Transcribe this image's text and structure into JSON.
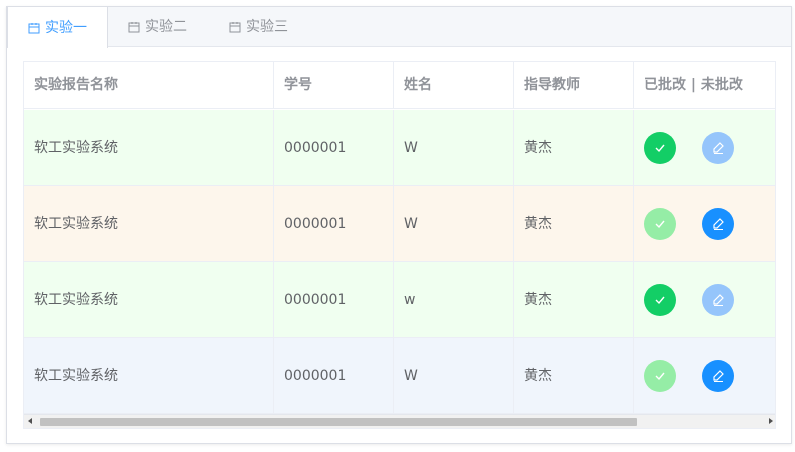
{
  "tabs": [
    {
      "label": "实验一",
      "active": true
    },
    {
      "label": "实验二",
      "active": false
    },
    {
      "label": "实验三",
      "active": false
    }
  ],
  "table": {
    "headers": [
      "实验报告名称",
      "学号",
      "姓名",
      "指导教师",
      "已批改 | 未批改"
    ],
    "rows": [
      {
        "name": "软工实验系统",
        "id": "0000001",
        "student": "W",
        "teacher": "黄杰",
        "bg": "#f0fff0",
        "graded_active": true
      },
      {
        "name": "软工实验系统",
        "id": "0000001",
        "student": "W",
        "teacher": "黄杰",
        "bg": "#fdf6ec",
        "graded_active": false
      },
      {
        "name": "软工实验系统",
        "id": "0000001",
        "student": "w",
        "teacher": "黄杰",
        "bg": "#f0fff0",
        "graded_active": true
      },
      {
        "name": "软工实验系统",
        "id": "0000001",
        "student": "W",
        "teacher": "黄杰",
        "bg": "#f0f5fc",
        "graded_active": false
      }
    ]
  },
  "colors": {
    "green_active": "#13ce66",
    "green_faded": "#95eda6",
    "blue_active": "#1890ff",
    "blue_faded": "#95c5fb",
    "tab_active": "#409eff"
  },
  "icons": {
    "tab": "calendar-icon",
    "graded": "check-icon",
    "ungraded": "edit-icon"
  }
}
